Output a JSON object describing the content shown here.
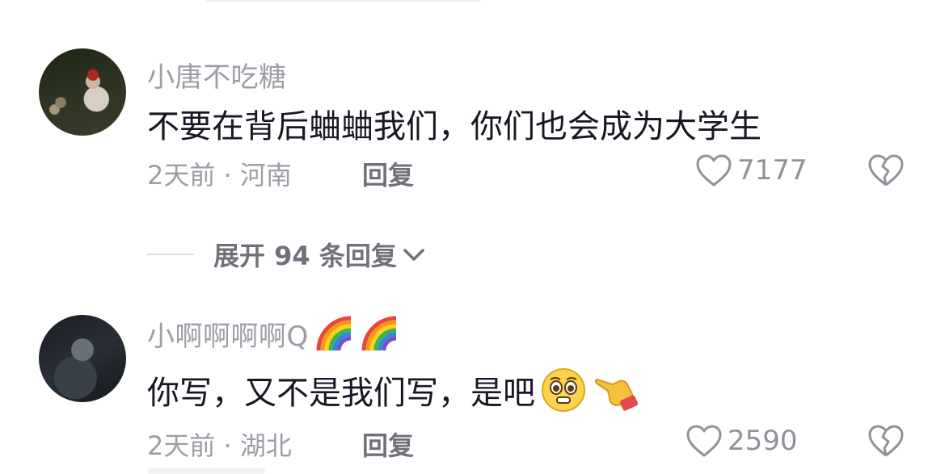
{
  "comments": [
    {
      "username": "小唐不吃糖",
      "text": "不要在背后蛐蛐我们，你们也会成为大学生",
      "meta": "2天前 · 河南",
      "reply_label": "回复",
      "likes": "7177",
      "avatar_icon": "user-avatar"
    },
    {
      "username": "小啊啊啊啊Q",
      "text": "你写，又不是我们写，是吧",
      "meta": "2天前 · 湖北",
      "reply_label": "回复",
      "likes": "2590",
      "avatar_icon": "user-avatar",
      "name_emojis": [
        "rainbow-icon",
        "rainbow-icon"
      ],
      "text_emojis": [
        "pleading-face-icon",
        "pointing-hand-icon"
      ]
    }
  ],
  "expand_replies": {
    "label": "展开 94 条回复"
  },
  "colors": {
    "primary_text": "#161823",
    "secondary_text": "#9b9ea6",
    "action_text": "#6e717a"
  }
}
